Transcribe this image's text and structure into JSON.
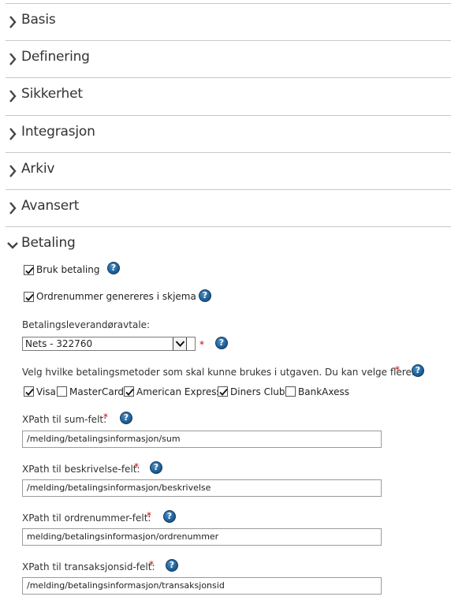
{
  "sections": [
    {
      "title": "Basis"
    },
    {
      "title": "Definering"
    },
    {
      "title": "Sikkerhet"
    },
    {
      "title": "Integrasjon"
    },
    {
      "title": "Arkiv"
    },
    {
      "title": "Avansert"
    },
    {
      "title": "Betaling"
    }
  ],
  "betaling": {
    "bruk_betaling": {
      "label": "Bruk betaling",
      "checked": true
    },
    "ordrenummer": {
      "label": "Ordrenummer genereres i skjema",
      "checked": true
    },
    "leverandor_label": "Betalingsleverandøravtale:",
    "leverandor_value": "Nets - 322760",
    "metoder_label": "Velg hvilke betalingsmetoder som skal kunne brukes i utgaven. Du kan velge flere:",
    "metoder": [
      {
        "label": "Visa",
        "checked": true
      },
      {
        "label": "MasterCard",
        "checked": false
      },
      {
        "label": "American Express",
        "checked": true
      },
      {
        "label": "Diners Club",
        "checked": true
      },
      {
        "label": "BankAxess",
        "checked": false
      }
    ],
    "required_mark": "*",
    "help_symbol": "?",
    "fields": [
      {
        "label": "XPath til sum-felt:",
        "value": "/melding/betalingsinformasjon/sum"
      },
      {
        "label": "XPath til beskrivelse-felt:",
        "value": "/melding/betalingsinformasjon/beskrivelse"
      },
      {
        "label": "XPath til ordrenummer-felt:",
        "value": "melding/betalingsinformasjon/ordrenummer"
      },
      {
        "label": "XPath til transaksjonsid-felt:",
        "value": "/melding/betalingsinformasjon/transaksjonsid"
      }
    ]
  }
}
